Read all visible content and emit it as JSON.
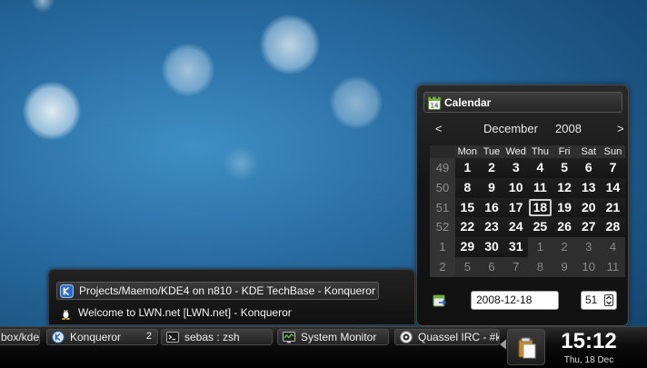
{
  "calendar": {
    "title": "Calendar",
    "prev_label": "<",
    "next_label": ">",
    "month": "December",
    "year": "2008",
    "day_names": [
      "Mon",
      "Tue",
      "Wed",
      "Thu",
      "Fri",
      "Sat",
      "Sun"
    ],
    "weeks": [
      {
        "week": "49",
        "days": [
          {
            "d": "1",
            "cur": true
          },
          {
            "d": "2",
            "cur": true
          },
          {
            "d": "3",
            "cur": true
          },
          {
            "d": "4",
            "cur": true
          },
          {
            "d": "5",
            "cur": true
          },
          {
            "d": "6",
            "cur": true
          },
          {
            "d": "7",
            "cur": true
          }
        ]
      },
      {
        "week": "50",
        "days": [
          {
            "d": "8",
            "cur": true
          },
          {
            "d": "9",
            "cur": true
          },
          {
            "d": "10",
            "cur": true
          },
          {
            "d": "11",
            "cur": true
          },
          {
            "d": "12",
            "cur": true
          },
          {
            "d": "13",
            "cur": true
          },
          {
            "d": "14",
            "cur": true
          }
        ]
      },
      {
        "week": "51",
        "days": [
          {
            "d": "15",
            "cur": true
          },
          {
            "d": "16",
            "cur": true
          },
          {
            "d": "17",
            "cur": true
          },
          {
            "d": "18",
            "cur": true,
            "today": true
          },
          {
            "d": "19",
            "cur": true
          },
          {
            "d": "20",
            "cur": true
          },
          {
            "d": "21",
            "cur": true
          }
        ]
      },
      {
        "week": "52",
        "days": [
          {
            "d": "22",
            "cur": true
          },
          {
            "d": "23",
            "cur": true
          },
          {
            "d": "24",
            "cur": true
          },
          {
            "d": "25",
            "cur": true
          },
          {
            "d": "26",
            "cur": true
          },
          {
            "d": "27",
            "cur": true
          },
          {
            "d": "28",
            "cur": true
          }
        ]
      },
      {
        "week": "1",
        "days": [
          {
            "d": "29",
            "cur": true
          },
          {
            "d": "30",
            "cur": true
          },
          {
            "d": "31",
            "cur": true
          },
          {
            "d": "1",
            "cur": false
          },
          {
            "d": "2",
            "cur": false
          },
          {
            "d": "3",
            "cur": false
          },
          {
            "d": "4",
            "cur": false
          }
        ]
      },
      {
        "week": "2",
        "days": [
          {
            "d": "5",
            "cur": false
          },
          {
            "d": "6",
            "cur": false
          },
          {
            "d": "7",
            "cur": false
          },
          {
            "d": "8",
            "cur": false
          },
          {
            "d": "9",
            "cur": false
          },
          {
            "d": "10",
            "cur": false
          },
          {
            "d": "11",
            "cur": false
          }
        ]
      }
    ],
    "date_value": "2008-12-18",
    "week_value": "51"
  },
  "task_popup": {
    "items": [
      {
        "label": "Projects/Maemo/KDE4 on n810 - KDE TechBase - Konqueror",
        "icon": "kde-icon",
        "selected": true
      },
      {
        "label": "Welcome to LWN.net [LWN.net] - Konqueror",
        "icon": "tux-icon",
        "selected": false
      }
    ]
  },
  "taskbar": {
    "tasks": [
      {
        "label": "box/kde",
        "icon": "folder-icon"
      },
      {
        "label": "Konqueror",
        "icon": "konqueror-icon",
        "count": "2"
      },
      {
        "label": "sebas : zsh",
        "icon": "terminal-icon"
      },
      {
        "label": "System Monitor",
        "icon": "system-monitor-icon"
      },
      {
        "label": "Quassel IRC - #kde",
        "icon": "quassel-icon"
      }
    ],
    "clock_time": "15:12",
    "clock_date": "Thu, 18 Dec"
  },
  "colors": {
    "panel_bg": "#111111",
    "accent_white": "#ffffff",
    "wallpaper": "#2a6ea3"
  }
}
